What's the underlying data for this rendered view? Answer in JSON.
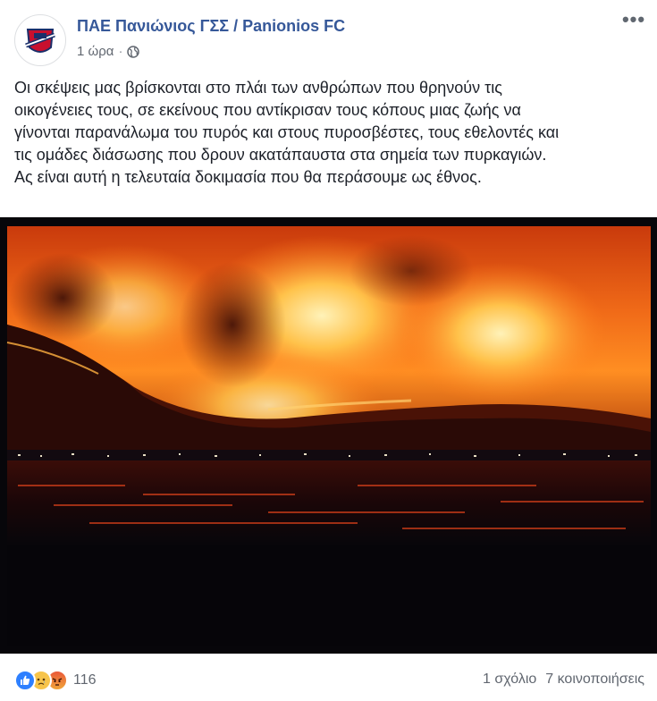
{
  "header": {
    "page_name": "ΠΑΕ Πανιώνιος ΓΣΣ / Panionios FC",
    "time": "1 ώρα",
    "separator": "·",
    "privacy_icon": "globe-icon",
    "more_icon": "more-options-icon",
    "more_label": "•••"
  },
  "post": {
    "lines": [
      "Οι σκέψεις μας βρίσκονται στο πλάι των ανθρώπων που θρηνούν τις",
      "οικογένειες τους, σε εκείνους που αντίκρισαν τους κόπους μιας ζωής να",
      "γίνονται παρανάλωμα του πυρός και στους πυροσβέστες, τους εθελοντές και",
      "τις ομάδες διάσωσης που δρουν ακατάπαυστα στα σημεία των πυρκαγιών.",
      "Ας είναι αυτή η τελευταία δοκιμασία που θα περάσουμε ως έθνος."
    ]
  },
  "footer": {
    "reaction_icons": [
      "like-icon",
      "sad-icon",
      "angry-icon"
    ],
    "reaction_count": "116",
    "comments": "1 σχόλιο",
    "shares": "7 κοινοποιήσεις"
  },
  "colors": {
    "page_name": "#365899",
    "meta": "#616770",
    "text": "#1d2129",
    "like": "#2e80ff",
    "sad": "#f7c44a",
    "angry": "#e9593a"
  }
}
